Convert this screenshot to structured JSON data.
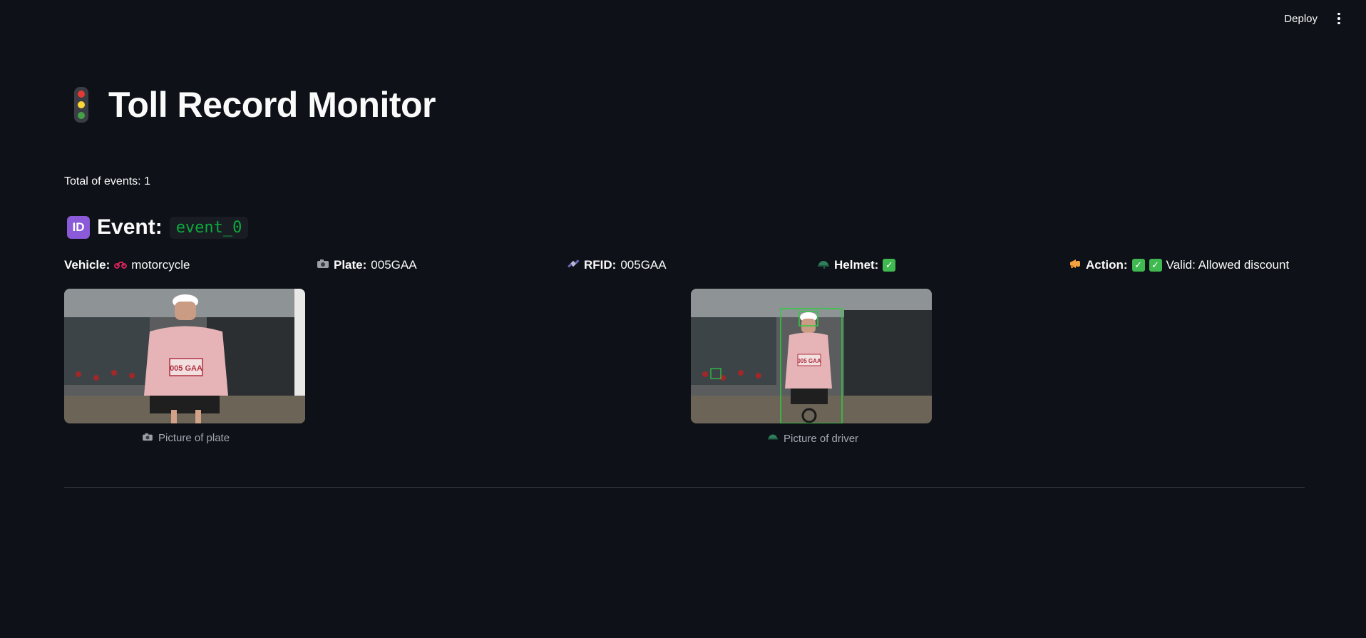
{
  "toolbar": {
    "deploy_label": "Deploy"
  },
  "header": {
    "title": "Toll Record Monitor"
  },
  "summary": {
    "total_label": "Total of events: 1"
  },
  "event": {
    "badge": "ID",
    "label": "Event:",
    "id": "event_0",
    "vehicle": {
      "label": "Vehicle:",
      "value": "motorcycle",
      "icon": "motorcycle-icon"
    },
    "plate": {
      "label": "Plate:",
      "value": "005GAA",
      "icon": "camera-icon"
    },
    "rfid": {
      "label": "RFID:",
      "value": "005GAA",
      "icon": "satellite-icon"
    },
    "helmet": {
      "label": "Helmet:",
      "icon": "helmet-icon",
      "status": "check"
    },
    "action": {
      "label": "Action:",
      "icon": "megaphone-icon",
      "status": "check",
      "valid_text": "Valid: Allowed discount"
    },
    "plate_picture": {
      "caption": "Picture of plate",
      "plate_text": "005 GAA"
    },
    "driver_picture": {
      "caption": "Picture of driver",
      "plate_text": "005 GAA"
    }
  },
  "colors": {
    "background": "#0e1117",
    "code": "#09ab3b",
    "check": "#3fb950",
    "detection_box": "#2ecc40"
  }
}
